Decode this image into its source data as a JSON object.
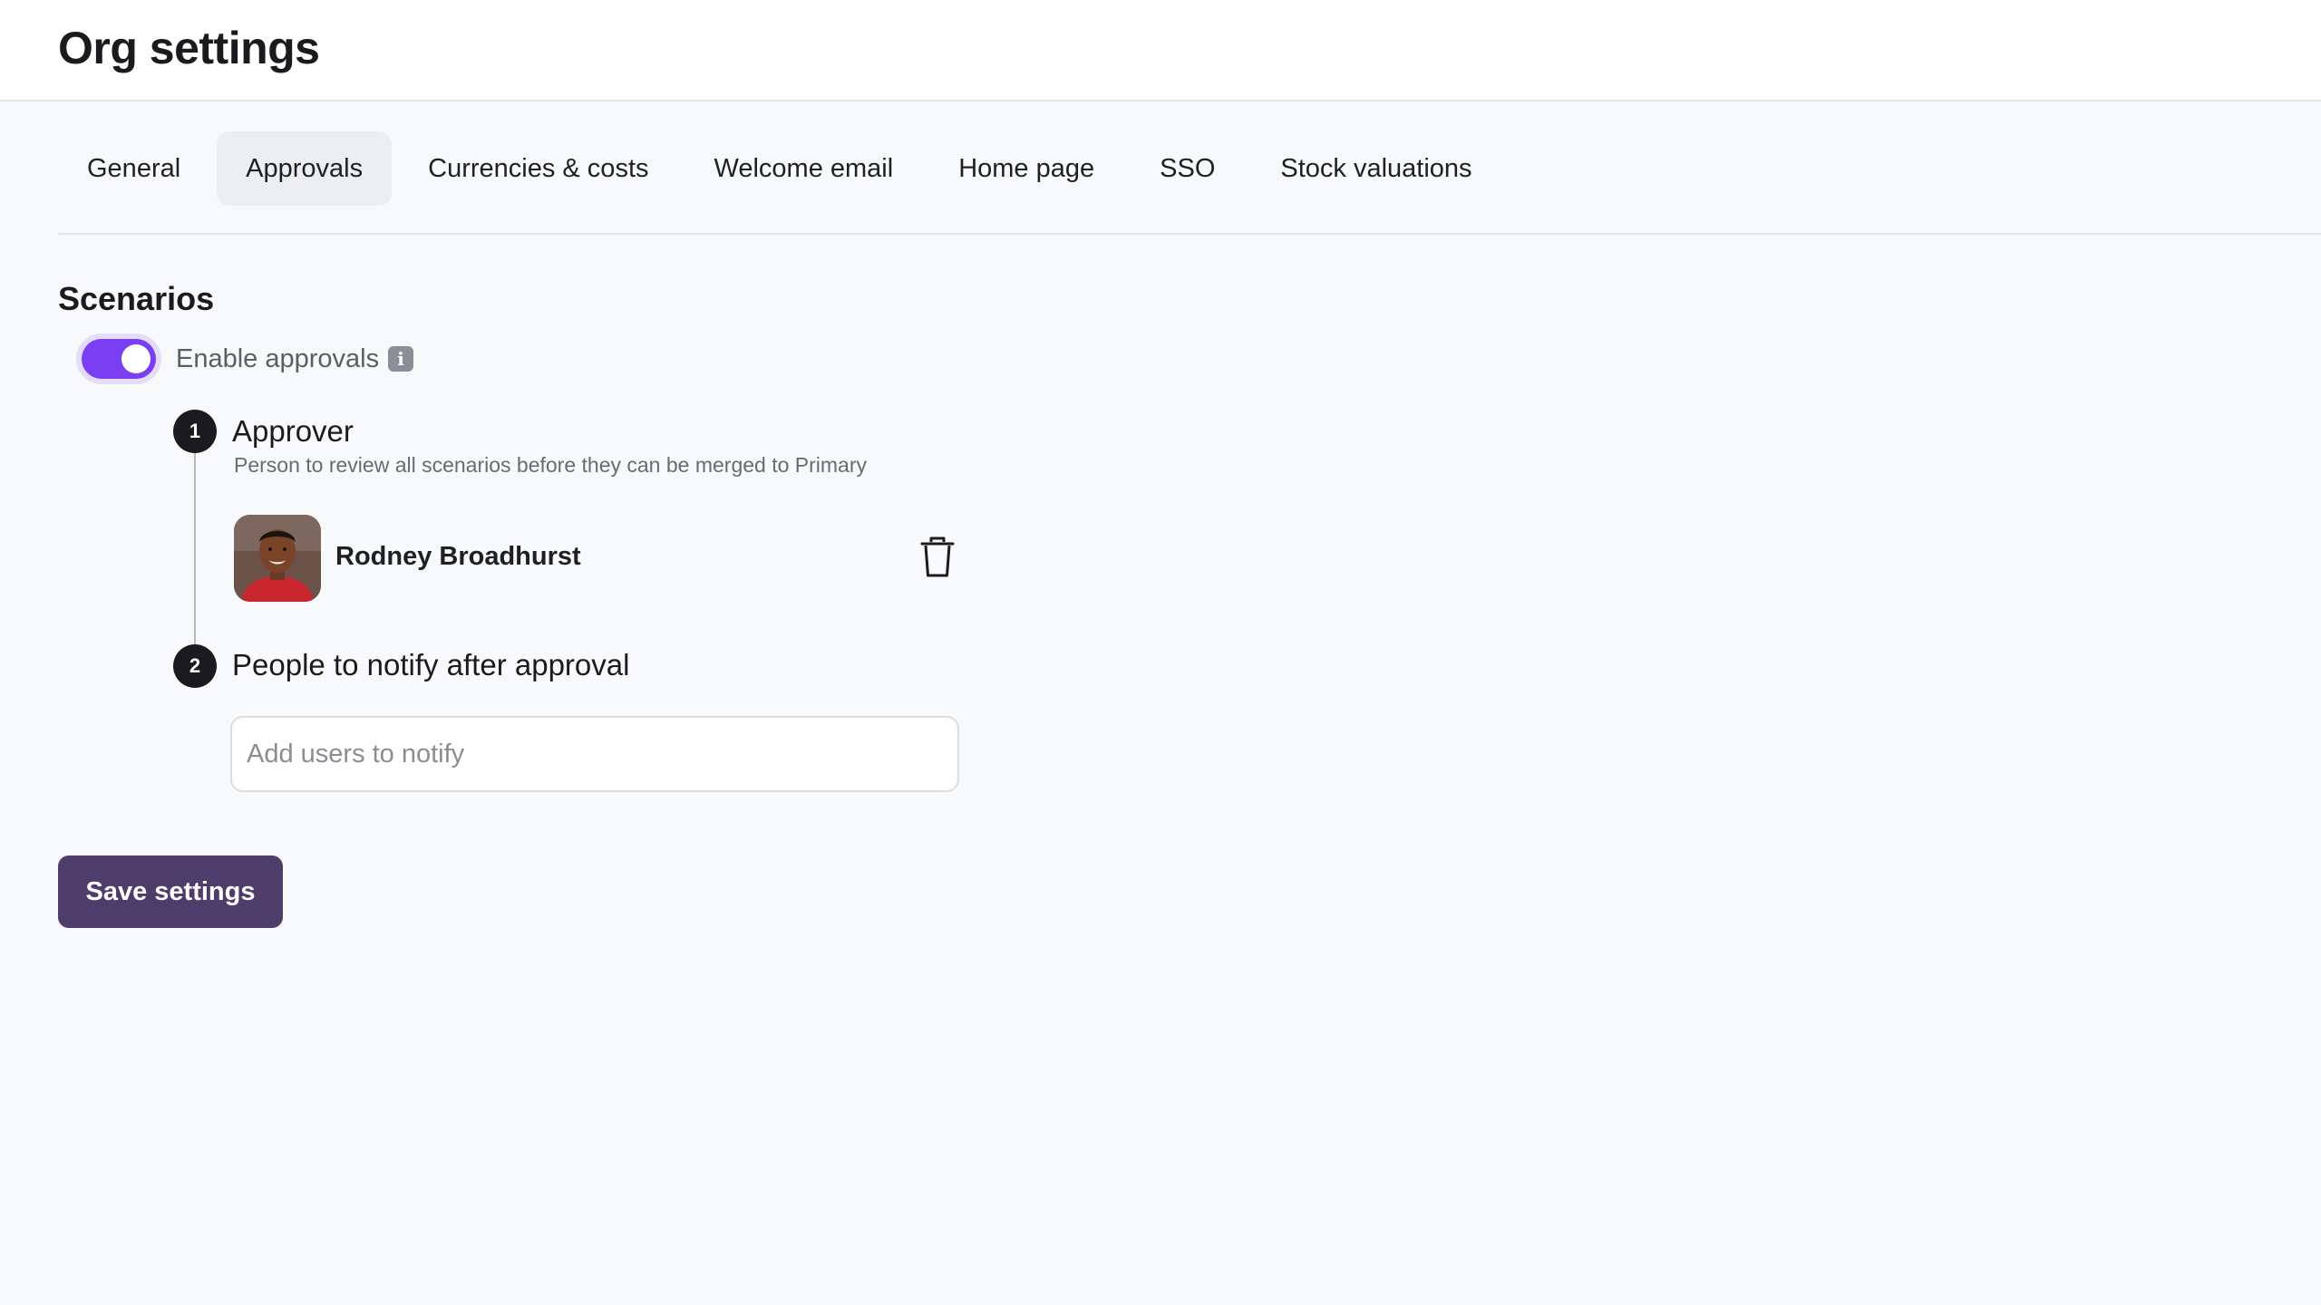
{
  "page": {
    "title": "Org settings"
  },
  "tabs": [
    {
      "label": "General"
    },
    {
      "label": "Approvals",
      "active": true
    },
    {
      "label": "Currencies & costs"
    },
    {
      "label": "Welcome email"
    },
    {
      "label": "Home page"
    },
    {
      "label": "SSO"
    },
    {
      "label": "Stock valuations"
    }
  ],
  "scenarios": {
    "title": "Scenarios",
    "toggle": {
      "label": "Enable approvals",
      "enabled": true,
      "icon": "info-icon"
    },
    "steps": [
      {
        "number": "1",
        "title": "Approver",
        "description": "Person to review all scenarios before they can be merged to Primary",
        "approver": {
          "name": "Rodney Broadhurst",
          "delete_icon": "trash-icon"
        }
      },
      {
        "number": "2",
        "title": "People to notify after approval",
        "input": {
          "value": "",
          "placeholder": "Add users to notify"
        }
      }
    ]
  },
  "actions": {
    "save_label": "Save settings"
  },
  "colors": {
    "toggle_on": "#7a3ff3",
    "save_button": "#4e3c6b",
    "step_badge": "#1b1b1f",
    "active_tab_bg": "#eceef2"
  }
}
